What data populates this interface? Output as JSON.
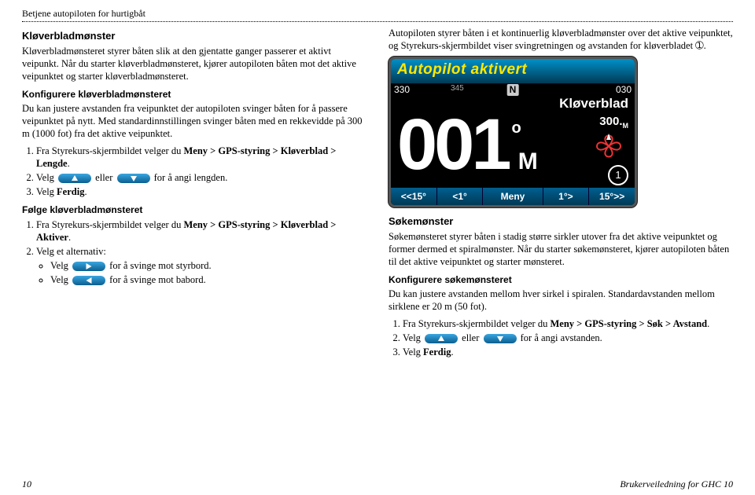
{
  "header": "Betjene autopiloten for hurtigbåt",
  "left": {
    "h1": "Kløverbladmønster",
    "p1": "Kløverbladmønsteret styrer båten slik at den gjentatte ganger passerer et aktivt veipunkt. Når du starter kløverbladmønsteret, kjører autopiloten båten mot det aktive veipunktet og starter kløverbladmønsteret.",
    "h2": "Konfigurere kløverbladmønsteret",
    "p2": "Du kan justere avstanden fra veipunktet der autopiloten svinger båten for å passere veipunktet på nytt. Med standardinnstillingen svinger båten med en rekkevidde på 300 m (1000 fot) fra det aktive veipunktet.",
    "ol1_1a": "Fra Styrekurs-skjermbildet velger du ",
    "ol1_1b": "Meny > GPS-styring > Kløverblad > Lengde",
    "ol1_2a": "Velg ",
    "ol1_2b": " eller ",
    "ol1_2c": " for å angi lengden.",
    "ol1_3a": "Velg ",
    "ol1_3b": "Ferdig",
    "h3": "Følge kløverbladmønsteret",
    "ol2_1a": "Fra Styrekurs-skjermbildet velger du ",
    "ol2_1b": "Meny > GPS-styring > Kløverblad > Aktiver",
    "ol2_2": "Velg et alternativ:",
    "b1a": "Velg ",
    "b1b": " for å svinge mot styrbord.",
    "b2a": "Velg ",
    "b2b": " for å svinge mot babord."
  },
  "right": {
    "p1": "Autopiloten styrer båten i et kontinuerlig kløverbladmønster over det aktive veipunktet, og Styrekurs-skjermbildet viser svingretningen og avstanden for kløverbladet ➀.",
    "h1": "Søkemønster",
    "p2": "Søkemønsteret styrer båten i stadig større sirkler utover fra det aktive veipunktet og former dermed et spiralmønster. Når du starter søkemønsteret, kjører autopiloten båten til det aktive veipunktet og starter mønsteret.",
    "h2": "Konfigurere søkemønsteret",
    "p3": "Du kan justere avstanden mellom hver sirkel i spiralen. Standardavstanden mellom sirklene er 20 m (50 fot).",
    "ol1_1a": "Fra Styrekurs-skjermbildet velger du ",
    "ol1_1b": "Meny > GPS-styring > Søk > Avstand",
    "ol1_2a": "Velg ",
    "ol1_2b": " eller ",
    "ol1_2c": " for å angi avstanden.",
    "ol1_3a": "Velg ",
    "ol1_3b": "Ferdig"
  },
  "screen": {
    "title": "Autopilot aktivert",
    "tick330": "330",
    "tick345": "345",
    "n": "N",
    "tick030": "030",
    "mode": "Kløverblad",
    "heading": "001",
    "deg": "o",
    "unit": "M",
    "dist": "300.",
    "distUnit": "M",
    "marker": "1",
    "k1": "<<15°",
    "k2": "<1°",
    "k3": "Meny",
    "k4": "1°>",
    "k5": "15°>>"
  },
  "footer": {
    "page": "10",
    "doc": "Brukerveiledning for GHC 10"
  }
}
